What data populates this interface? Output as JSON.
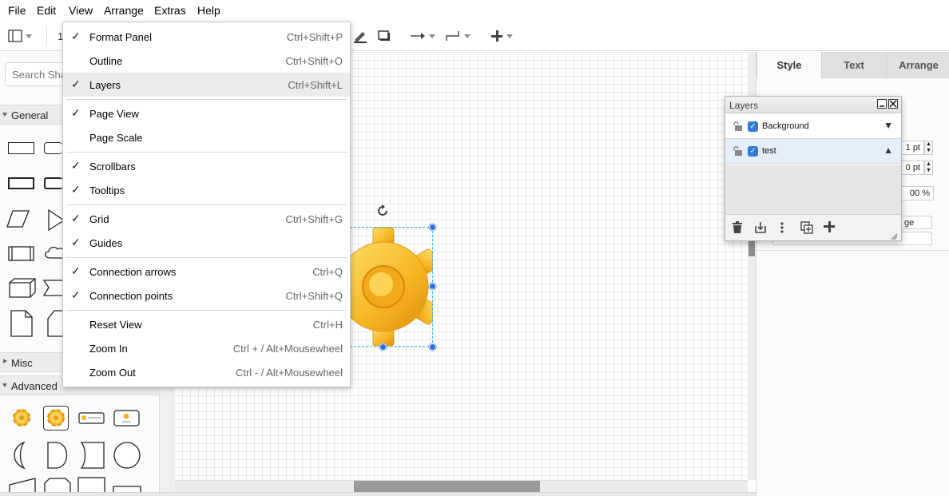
{
  "menubar": {
    "items": [
      "File",
      "Edit",
      "View",
      "Arrange",
      "Extras",
      "Help"
    ]
  },
  "toolbar": {
    "zoom_partial": "1"
  },
  "sidebar": {
    "search_placeholder": "Search Sha",
    "sections": {
      "general": "General",
      "misc": "Misc",
      "advanced": "Advanced"
    }
  },
  "view_menu": {
    "items": [
      {
        "label": "Format Panel",
        "shortcut": "Ctrl+Shift+P",
        "checked": true
      },
      {
        "label": "Outline",
        "shortcut": "Ctrl+Shift+O",
        "checked": false
      },
      {
        "label": "Layers",
        "shortcut": "Ctrl+Shift+L",
        "checked": true
      },
      {
        "label": "Page View",
        "shortcut": "",
        "checked": true
      },
      {
        "label": "Page Scale",
        "shortcut": "",
        "checked": false
      },
      {
        "label": "Scrollbars",
        "shortcut": "",
        "checked": true
      },
      {
        "label": "Tooltips",
        "shortcut": "",
        "checked": true
      },
      {
        "label": "Grid",
        "shortcut": "Ctrl+Shift+G",
        "checked": true
      },
      {
        "label": "Guides",
        "shortcut": "",
        "checked": true
      },
      {
        "label": "Connection arrows",
        "shortcut": "Ctrl+Q",
        "checked": true
      },
      {
        "label": "Connection points",
        "shortcut": "Ctrl+Shift+Q",
        "checked": true
      },
      {
        "label": "Reset View",
        "shortcut": "Ctrl+H",
        "checked": false
      },
      {
        "label": "Zoom In",
        "shortcut": "Ctrl + / Alt+Mousewheel",
        "checked": false
      },
      {
        "label": "Zoom Out",
        "shortcut": "Ctrl - / Alt+Mousewheel",
        "checked": false
      }
    ],
    "check_glyph": "✓"
  },
  "format_panel": {
    "tabs": [
      "Style",
      "Text",
      "Arrange"
    ],
    "active_tab": "Style",
    "fields": [
      "1 pt",
      "0 pt",
      "00 %"
    ],
    "partial_button": "ge"
  },
  "layers_dialog": {
    "title": "Layers",
    "layers": [
      {
        "name": "Background",
        "visible": true,
        "arrow": "▼"
      },
      {
        "name": "test",
        "visible": true,
        "arrow": "▲"
      }
    ],
    "check_glyph": "✓"
  },
  "icons": {
    "gear": "gear-icon",
    "rotate": "rotate-icon"
  },
  "colors": {
    "accent": "#2a72d9",
    "selection": "#29b6f2",
    "gear_light": "#fde16b",
    "gear_dark": "#e59a14",
    "menu_highlight": "#ebebeb"
  }
}
